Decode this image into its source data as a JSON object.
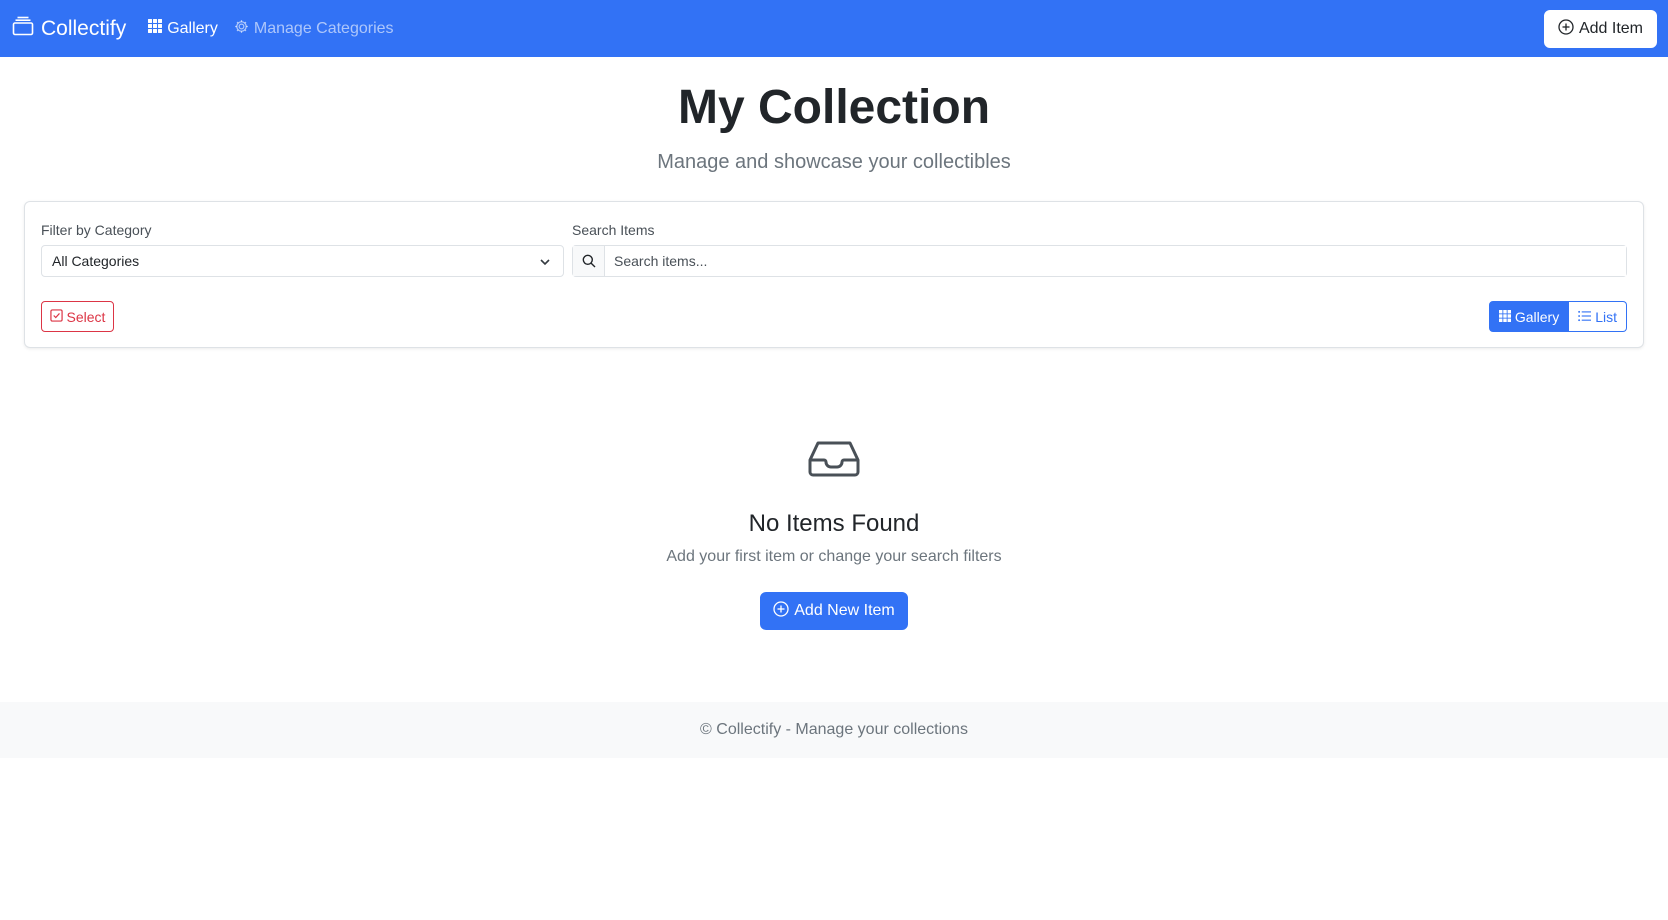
{
  "navbar": {
    "brand": "Collectify",
    "links": [
      {
        "label": "Gallery",
        "icon": "grid-icon"
      },
      {
        "label": "Manage Categories",
        "icon": "gear-icon"
      }
    ],
    "add_item_label": "Add Item"
  },
  "header": {
    "title": "My Collection",
    "subtitle": "Manage and showcase your collectibles"
  },
  "filters": {
    "category_label": "Filter by Category",
    "category_value": "All Categories",
    "search_label": "Search Items",
    "search_placeholder": "Search items...",
    "search_value": "",
    "select_label": "Select",
    "views": [
      {
        "label": "Gallery",
        "active": true
      },
      {
        "label": "List",
        "active": false
      }
    ]
  },
  "empty_state": {
    "icon": "inbox-icon",
    "title": "No Items Found",
    "text": "Add your first item or change your search filters",
    "button_label": "Add New Item"
  },
  "footer": {
    "text": "© Collectify - Manage your collections"
  },
  "colors": {
    "primary": "#3272f5",
    "danger": "#dc3545",
    "muted": "#6c757d"
  }
}
